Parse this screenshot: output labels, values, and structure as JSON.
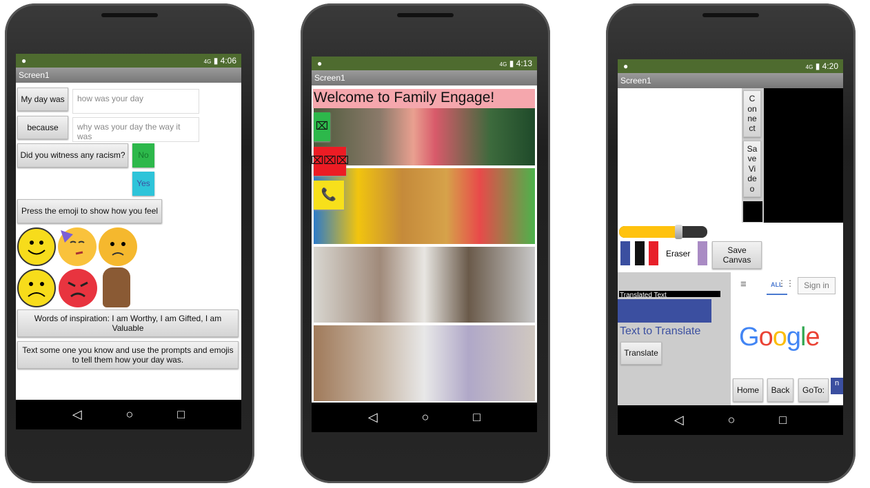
{
  "phones": [
    {
      "status_time": "4:06",
      "title": "Screen1",
      "day_button": "My day was",
      "day_placeholder": "how was your day",
      "because_button": "because",
      "because_placeholder": "why was your day the way it was",
      "racism_button": "Did you witness any racism?",
      "no": "No",
      "yes": "Yes",
      "emoji_prompt": "Press the emoji to show how you feel",
      "emojis": [
        "smiling-face-icon",
        "party-face-icon",
        "worried-face-icon",
        "sad-face-icon",
        "angry-face-icon",
        "raised-fist-icon"
      ],
      "inspiration": "Words of inspiration: I am Worthy, I am Gifted, I am Valuable",
      "text_someone": "Text some one you know and  use the prompts and emojis to tell them how your day was."
    },
    {
      "status_time": "4:13",
      "title": "Screen1",
      "welcome": "Welcome to Family Engage!",
      "icon_buttons": [
        "⌧",
        "⌧⌧⌧",
        "📞"
      ]
    },
    {
      "status_time": "4:20",
      "title": "Screen1",
      "connect": "C\non\nne\nct",
      "save_video": "Sa\nve\nVi\nde\no",
      "slider_fraction": 0.2,
      "colors": [
        "#3b4fa0",
        "#111111",
        "#e8202a",
        "#a98bc4"
      ],
      "eraser": "Eraser",
      "save_canvas": "Save\nCanvas",
      "translated_text": "Translated Text",
      "text_to_translate": "Text to Translate",
      "translate": "Translate",
      "web": {
        "all_tab": "ALL",
        "sign_in": "Sign in",
        "logo": "Google",
        "home": "Home",
        "back": "Back",
        "goto": "GoTo:",
        "cut": "n"
      }
    }
  ],
  "nav": {
    "back": "◁",
    "home": "○",
    "recents": "□"
  },
  "status_icons": {
    "signal": "4G",
    "battery": "▮"
  }
}
